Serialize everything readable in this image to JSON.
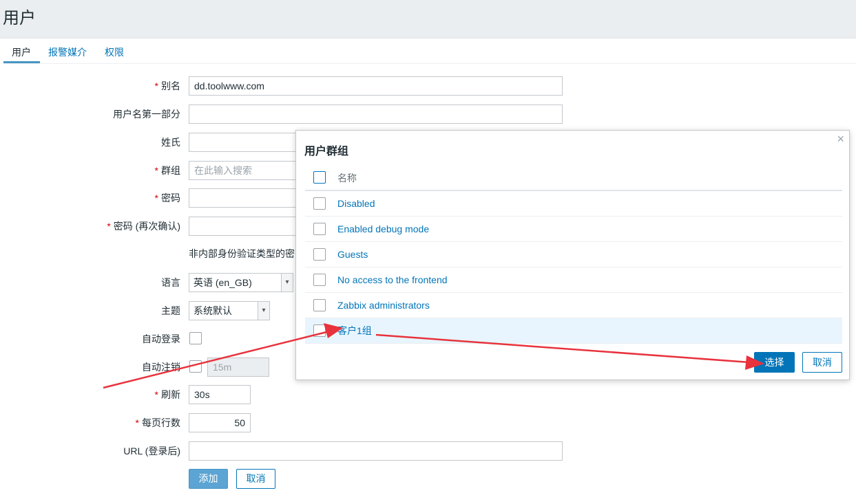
{
  "page": {
    "title": "用户"
  },
  "tabs": [
    {
      "label": "用户",
      "active": true
    },
    {
      "label": "报警媒介",
      "active": false
    },
    {
      "label": "权限",
      "active": false
    }
  ],
  "form": {
    "alias": {
      "label": "别名",
      "required": true,
      "value": "dd.toolwww.com"
    },
    "name": {
      "label": "用户名第一部分",
      "value": ""
    },
    "surname": {
      "label": "姓氏",
      "value": ""
    },
    "groups": {
      "label": "群组",
      "required": true,
      "placeholder": "在此输入搜索"
    },
    "password": {
      "label": "密码",
      "required": true,
      "value": ""
    },
    "password_confirm": {
      "label": "密码 (再次确认)",
      "required": true,
      "value": ""
    },
    "password_note": "非内部身份验证类型的密",
    "language": {
      "label": "语言",
      "value": "英语 (en_GB)"
    },
    "theme": {
      "label": "主题",
      "value": "系统默认"
    },
    "autologin": {
      "label": "自动登录",
      "checked": false
    },
    "autologout": {
      "label": "自动注销",
      "checked": false,
      "value": "15m"
    },
    "refresh": {
      "label": "刷新",
      "required": true,
      "value": "30s"
    },
    "rows_per_page": {
      "label": "每页行数",
      "required": true,
      "value": "50"
    },
    "url": {
      "label": "URL (登录后)",
      "value": ""
    },
    "add_button": "添加",
    "cancel_button": "取消"
  },
  "modal": {
    "title": "用户群组",
    "close_icon": "×",
    "column_name": "名称",
    "rows": [
      {
        "name": "Disabled",
        "checked": false
      },
      {
        "name": "Enabled debug mode",
        "checked": false
      },
      {
        "name": "Guests",
        "checked": false
      },
      {
        "name": "No access to the frontend",
        "checked": false
      },
      {
        "name": "Zabbix administrators",
        "checked": false
      },
      {
        "name": "客户1组",
        "checked": false,
        "highlighted": true
      }
    ],
    "select_button": "选择",
    "cancel_button": "取消"
  },
  "colors": {
    "link": "#0275b8",
    "required": "#d40000",
    "annotation_arrow": "#e8323c",
    "highlight_row": "#e8f5ff"
  }
}
